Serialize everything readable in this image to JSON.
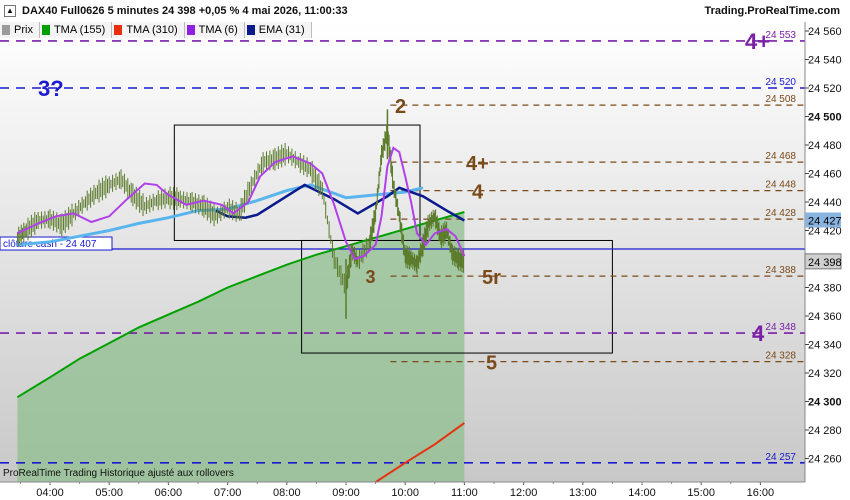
{
  "header": {
    "title": "DAX40 Full0626 5 minutes 24 398 +0,05 % 4 mai 2026, 11:00:33",
    "brand": "Trading.ProRealTime.com"
  },
  "legend": [
    {
      "label": "Prix",
      "color": "#9b9b9b"
    },
    {
      "label": "TMA (155)",
      "color": "#00a000"
    },
    {
      "label": "TMA (310)",
      "color": "#e83010"
    },
    {
      "label": "TMA (6)",
      "color": "#9020e0"
    },
    {
      "label": "EMA (31)",
      "color": "#0a1a8c"
    }
  ],
  "footer_note": "ProRealTime Trading  Historique ajusté aux rollovers",
  "chart_data": {
    "type": "line",
    "title": "DAX40 Full0626 5 minutes",
    "ylim": [
      24245,
      24570
    ],
    "y_ticks": [
      24260,
      24280,
      24300,
      24320,
      24340,
      24360,
      24380,
      24400,
      24420,
      24440,
      24460,
      24480,
      24500,
      24520,
      24540,
      24560
    ],
    "y_ticks_bold": [
      24300,
      24400,
      24500
    ],
    "x_ticks": [
      "04:00",
      "05:00",
      "06:00",
      "07:00",
      "08:00",
      "09:00",
      "10:00",
      "11:00",
      "12:00",
      "13:00",
      "14:00",
      "15:00",
      "16:00"
    ],
    "last_price": {
      "label": "24 398",
      "value": 24398
    },
    "ema_label": {
      "label": "24 427",
      "value": 24427
    },
    "cloture": {
      "label": "clôture cash -  24 407",
      "value": 24407
    },
    "levels": [
      {
        "value": 24553,
        "text": "4+",
        "color": "#7a1fa8",
        "style": "dash",
        "right_label": "24 553"
      },
      {
        "value": 24520,
        "text": "3?",
        "color": "#1a1ad0",
        "style": "dash",
        "right_label": "24 520"
      },
      {
        "value": 24508,
        "text": "2",
        "color": "#7a4a1a",
        "style": "dash",
        "right_label": "24 508"
      },
      {
        "value": 24468,
        "text": "4+",
        "color": "#7a4a1a",
        "style": "dash",
        "right_label": "24 468"
      },
      {
        "value": 24448,
        "text": "4",
        "color": "#7a4a1a",
        "style": "dash",
        "right_label": "24 448"
      },
      {
        "value": 24428,
        "text": "",
        "color": "#7a4a1a",
        "style": "dash",
        "right_label": "24 428"
      },
      {
        "value": 24388,
        "text": "5r",
        "color": "#7a4a1a",
        "style": "dash",
        "right_label": "24 388"
      },
      {
        "value": 24348,
        "text": "4",
        "color": "#7a1fa8",
        "style": "dash",
        "right_label": "24 348"
      },
      {
        "value": 24328,
        "text": "5",
        "color": "#7a4a1a",
        "style": "dash",
        "right_label": "24 328"
      },
      {
        "value": 24257,
        "text": "",
        "color": "#1a1ad0",
        "style": "dash",
        "right_label": "24 257"
      }
    ],
    "extra_labels": [
      {
        "text": "3",
        "time": 9.7,
        "value": 24388,
        "color": "#7a4a1a"
      }
    ],
    "boxes": [
      {
        "t0": 6.1,
        "t1": 10.25,
        "top": 24494,
        "bottom": 24413
      },
      {
        "t0": 8.25,
        "t1": 13.5,
        "top": 24413,
        "bottom": 24334
      }
    ],
    "tma155": [
      [
        3.45,
        24303
      ],
      [
        4.0,
        24317
      ],
      [
        4.5,
        24330
      ],
      [
        5.0,
        24341
      ],
      [
        5.5,
        24352
      ],
      [
        6.0,
        24361
      ],
      [
        6.5,
        24370
      ],
      [
        7.0,
        24380
      ],
      [
        7.5,
        24388
      ],
      [
        8.0,
        24396
      ],
      [
        8.5,
        24403
      ],
      [
        9.0,
        24409
      ],
      [
        9.5,
        24415
      ],
      [
        10.0,
        24421
      ],
      [
        10.5,
        24427
      ],
      [
        11.0,
        24433
      ]
    ],
    "tma310": [
      [
        9.0,
        24230
      ],
      [
        10.0,
        24257
      ],
      [
        10.5,
        24270
      ],
      [
        11.0,
        24285
      ]
    ],
    "ema31_light": [
      [
        3.45,
        24410
      ],
      [
        4.0,
        24412
      ],
      [
        4.5,
        24416
      ],
      [
        5.0,
        24420
      ],
      [
        5.5,
        24425
      ],
      [
        6.0,
        24429
      ],
      [
        6.5,
        24434
      ],
      [
        7.0,
        24435
      ],
      [
        7.5,
        24441
      ],
      [
        8.0,
        24448
      ],
      [
        8.4,
        24452
      ],
      [
        9.0,
        24443
      ],
      [
        9.5,
        24445
      ],
      [
        10.0,
        24447
      ],
      [
        10.3,
        24450
      ]
    ],
    "ema31_dark": [
      [
        6.8,
        24434
      ],
      [
        7.0,
        24430
      ],
      [
        7.3,
        24429
      ],
      [
        7.5,
        24431
      ],
      [
        8.3,
        24452
      ],
      [
        8.8,
        24442
      ],
      [
        9.2,
        24432
      ],
      [
        9.7,
        24444
      ],
      [
        9.9,
        24450
      ],
      [
        10.3,
        24444
      ],
      [
        10.7,
        24434
      ],
      [
        11.0,
        24427
      ]
    ],
    "tma6": [
      [
        3.45,
        24418
      ],
      [
        3.8,
        24425
      ],
      [
        4.1,
        24430
      ],
      [
        4.4,
        24432
      ],
      [
        4.7,
        24426
      ],
      [
        5.0,
        24430
      ],
      [
        5.3,
        24442
      ],
      [
        5.6,
        24453
      ],
      [
        5.8,
        24452
      ],
      [
        6.0,
        24445
      ],
      [
        6.3,
        24438
      ],
      [
        6.6,
        24441
      ],
      [
        6.9,
        24438
      ],
      [
        7.1,
        24432
      ],
      [
        7.35,
        24440
      ],
      [
        7.55,
        24458
      ],
      [
        7.8,
        24468
      ],
      [
        8.1,
        24472
      ],
      [
        8.4,
        24467
      ],
      [
        8.6,
        24460
      ],
      [
        8.8,
        24438
      ],
      [
        9.0,
        24412
      ],
      [
        9.15,
        24400
      ],
      [
        9.3,
        24402
      ],
      [
        9.5,
        24410
      ],
      [
        9.6,
        24430
      ],
      [
        9.7,
        24465
      ],
      [
        9.8,
        24478
      ],
      [
        9.9,
        24475
      ],
      [
        10.0,
        24458
      ],
      [
        10.1,
        24440
      ],
      [
        10.2,
        24418
      ],
      [
        10.35,
        24410
      ],
      [
        10.5,
        24418
      ],
      [
        10.7,
        24421
      ],
      [
        10.85,
        24416
      ],
      [
        11.0,
        24402
      ]
    ],
    "price": [
      [
        3.45,
        24415
      ],
      [
        3.6,
        24420
      ],
      [
        3.8,
        24427
      ],
      [
        4.0,
        24428
      ],
      [
        4.2,
        24424
      ],
      [
        4.4,
        24432
      ],
      [
        4.6,
        24440
      ],
      [
        4.8,
        24447
      ],
      [
        5.0,
        24452
      ],
      [
        5.2,
        24456
      ],
      [
        5.4,
        24445
      ],
      [
        5.6,
        24437
      ],
      [
        5.8,
        24441
      ],
      [
        6.0,
        24443
      ],
      [
        6.2,
        24442
      ],
      [
        6.4,
        24440
      ],
      [
        6.6,
        24437
      ],
      [
        6.8,
        24430
      ],
      [
        7.0,
        24436
      ],
      [
        7.2,
        24432
      ],
      [
        7.4,
        24452
      ],
      [
        7.6,
        24468
      ],
      [
        7.8,
        24470
      ],
      [
        8.0,
        24474
      ],
      [
        8.2,
        24468
      ],
      [
        8.4,
        24463
      ],
      [
        8.6,
        24448
      ],
      [
        8.8,
        24400
      ],
      [
        9.0,
        24380
      ],
      [
        9.1,
        24406
      ],
      [
        9.2,
        24398
      ],
      [
        9.4,
        24412
      ],
      [
        9.5,
        24432
      ],
      [
        9.6,
        24473
      ],
      [
        9.7,
        24490
      ],
      [
        9.8,
        24452
      ],
      [
        9.9,
        24430
      ],
      [
        10.0,
        24402
      ],
      [
        10.1,
        24400
      ],
      [
        10.2,
        24396
      ],
      [
        10.3,
        24410
      ],
      [
        10.4,
        24425
      ],
      [
        10.5,
        24430
      ],
      [
        10.6,
        24415
      ],
      [
        10.7,
        24420
      ],
      [
        10.8,
        24403
      ],
      [
        10.9,
        24400
      ],
      [
        11.0,
        24398
      ]
    ]
  }
}
